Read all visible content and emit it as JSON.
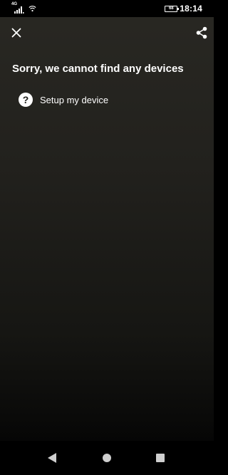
{
  "status_bar": {
    "network_type": "4G",
    "battery_level": "68",
    "time": "18:14",
    "icons": [
      "signal-icon",
      "wifi-icon",
      "battery-icon"
    ]
  },
  "header": {
    "close_icon": "close-icon",
    "share_icon": "share-icon"
  },
  "main": {
    "title": "Sorry, we cannot find any devices",
    "setup_item": {
      "icon": "help-icon",
      "icon_glyph": "?",
      "label": "Setup my device"
    }
  },
  "nav_bar": {
    "icons": [
      "back-icon",
      "home-icon",
      "recents-icon"
    ]
  },
  "colors": {
    "background_top": "#292823",
    "background_bottom": "#000000",
    "text": "#ffffff",
    "nav_icon": "#cfcfcf"
  }
}
